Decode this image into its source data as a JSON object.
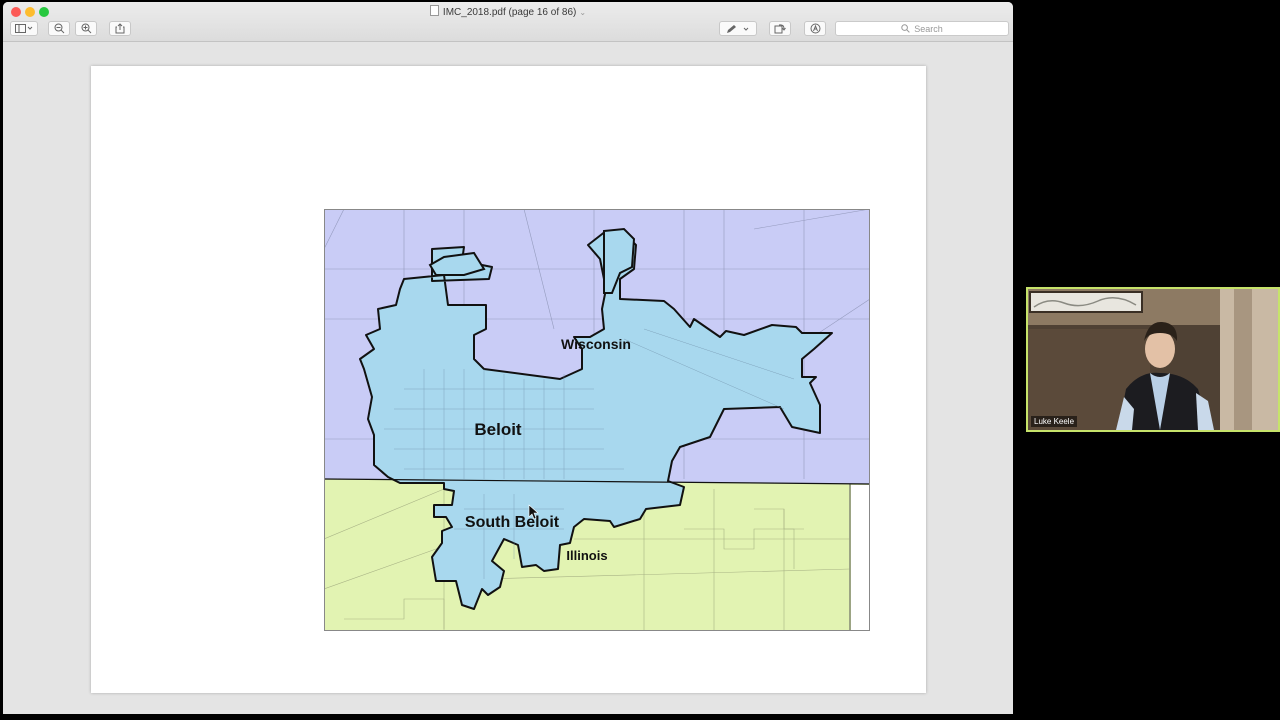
{
  "window": {
    "title": "IMC_2018.pdf (page 16 of 86)",
    "traffic_light_colors": {
      "close": "#fc5b57",
      "minimize": "#fdbc2e",
      "zoom": "#28c840"
    }
  },
  "toolbar": {
    "search_placeholder": "Search",
    "icons": [
      "sidebar-icon",
      "zoom-out-icon",
      "zoom-in-icon",
      "share-icon",
      "markup-pen-icon",
      "rotate-icon",
      "annotate-icon"
    ]
  },
  "document": {
    "map": {
      "labels": {
        "wisconsin": "Wisconsin",
        "beloit": "Beloit",
        "south_beloit": "South Beloit",
        "illinois": "Illinois"
      },
      "colors": {
        "wisconsin_fill": "#c9ccf6",
        "illinois_fill": "#e2f3b2",
        "city_fill": "#a8d8ee",
        "boundary": "#111111"
      }
    }
  },
  "participant": {
    "name": "Luke Keele",
    "border_color": "#c6e36a"
  }
}
